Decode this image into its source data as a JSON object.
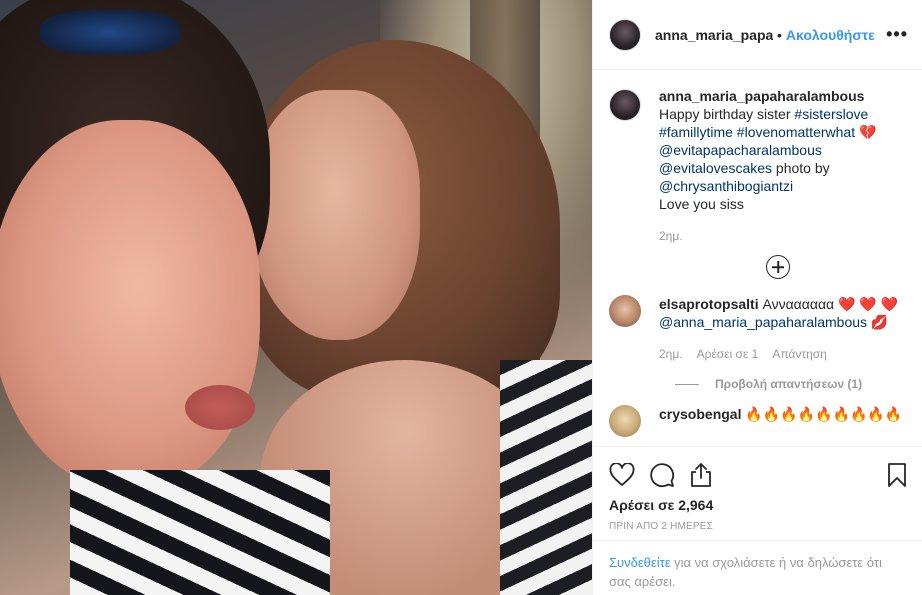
{
  "post": {
    "author": "anna_maria_papaharalambous",
    "header_username": "anna_maria_papah:",
    "follow_label": "Ακολουθήστε",
    "dot": "•",
    "more": "•••",
    "caption": {
      "username": "anna_maria_papaharalambous",
      "text1": " Happy birthday sister ",
      "tag1": "#sisterslove",
      "tag2": "#famillytime",
      "tag3": "#lovenomatterwhat",
      "emoji": "💔",
      "mention1": "@evitapapacharalambous",
      "mention2": "@evitalovescakes",
      "text2": " photo by",
      "mention3": "@chrysanthibogiantzi",
      "text3": "Love you siss",
      "age": "2ημ."
    }
  },
  "comments": [
    {
      "username": "elsaprotopsalti",
      "text": " Ανναααααα ",
      "hearts": "❤️ ❤️ ❤️",
      "mention": "@anna_maria_papaharalambous",
      "kiss": "💋",
      "age": "2ημ.",
      "likes": "Αρέσει σε 1",
      "reply": "Απάντηση",
      "view_replies": "Προβολή απαντήσεων (1)"
    },
    {
      "username": "crysobengal",
      "text": " 🔥🔥🔥🔥🔥🔥🔥🔥🔥"
    }
  ],
  "stats": {
    "likes": "Αρέσει σε 2,964",
    "time": "ΠΡΙΝ ΑΠΟ 2 ΗΜΕΡΕΣ"
  },
  "login": {
    "link": "Συνδεθείτε",
    "text": " για να σχολιάσετε ή να δηλώσετε ότι σας αρέσει."
  },
  "icons": {
    "like": "heart-icon",
    "comment": "comment-icon",
    "share": "share-icon",
    "save": "bookmark-icon",
    "load_more": "plus-circle-icon"
  },
  "colors": {
    "accent": "#3897f0",
    "link": "#003569",
    "muted": "#999999"
  }
}
